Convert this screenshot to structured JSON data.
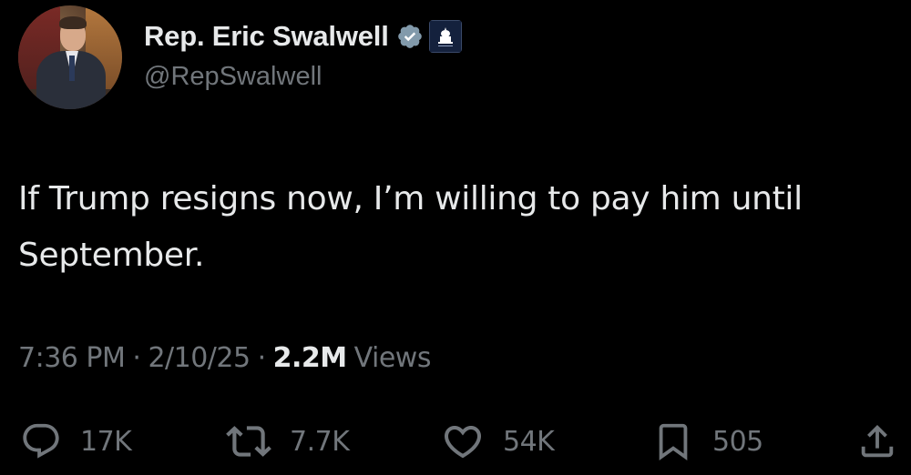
{
  "author": {
    "display_name": "Rep. Eric Swalwell",
    "handle": "@RepSwalwell",
    "verified_color": "#829aab"
  },
  "tweet": {
    "text": "If Trump resigns now, I’m willing to pay him until September.",
    "time": "7:36 PM",
    "date": "2/10/25",
    "separator": "·",
    "views_count": "2.2M",
    "views_label": "Views"
  },
  "actions": {
    "replies": "17K",
    "reposts": "7.7K",
    "likes": "54K",
    "bookmarks": "505"
  },
  "colors": {
    "background": "#000000",
    "primary_text": "#e7e9ea",
    "secondary_text": "#71767b"
  }
}
